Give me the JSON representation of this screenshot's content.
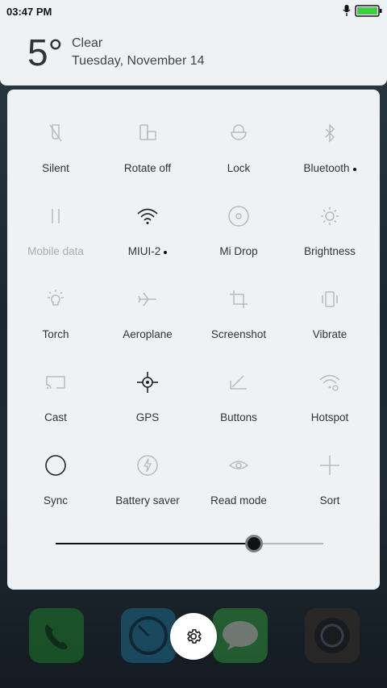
{
  "status_bar": {
    "time": "03:47 PM",
    "battery_icon": "battery-full-icon",
    "mic_icon": "microphone-icon"
  },
  "weather": {
    "temperature": "5°",
    "condition": "Clear",
    "date": "Tuesday, November 14"
  },
  "tiles": [
    {
      "label": "Silent",
      "icon": "silent-icon",
      "active": false
    },
    {
      "label": "Rotate off",
      "icon": "rotate-icon",
      "active": false
    },
    {
      "label": "Lock",
      "icon": "lock-icon",
      "active": false
    },
    {
      "label": "Bluetooth",
      "icon": "bluetooth-icon",
      "active": false,
      "dot": true
    },
    {
      "label": "Mobile data",
      "icon": "mobile-data-icon",
      "active": false,
      "disabled": true
    },
    {
      "label": "MIUI-2",
      "icon": "wifi-icon",
      "active": true,
      "dot": true
    },
    {
      "label": "Mi Drop",
      "icon": "mi-drop-icon",
      "active": false
    },
    {
      "label": "Brightness",
      "icon": "brightness-icon",
      "active": false
    },
    {
      "label": "Torch",
      "icon": "torch-icon",
      "active": false
    },
    {
      "label": "Aeroplane",
      "icon": "aeroplane-icon",
      "active": false
    },
    {
      "label": "Screenshot",
      "icon": "screenshot-icon",
      "active": false
    },
    {
      "label": "Vibrate",
      "icon": "vibrate-icon",
      "active": false
    },
    {
      "label": "Cast",
      "icon": "cast-icon",
      "active": false
    },
    {
      "label": "GPS",
      "icon": "gps-icon",
      "active": true
    },
    {
      "label": "Buttons",
      "icon": "buttons-icon",
      "active": false
    },
    {
      "label": "Hotspot",
      "icon": "hotspot-icon",
      "active": false
    },
    {
      "label": "Sync",
      "icon": "sync-icon",
      "active": true
    },
    {
      "label": "Battery saver",
      "icon": "battery-saver-icon",
      "active": false
    },
    {
      "label": "Read mode",
      "icon": "read-mode-icon",
      "active": false
    },
    {
      "label": "Sort",
      "icon": "sort-icon",
      "active": false
    }
  ],
  "brightness_level": 0.74,
  "colors": {
    "active_icon": "#222222",
    "inactive_icon": "#b6bbbe",
    "panel_bg": "#eef2f4"
  },
  "dock": [
    {
      "icon": "phone-icon",
      "color": "#1f7a2c"
    },
    {
      "icon": "browser-icon",
      "color": "#1d6b8c"
    },
    {
      "icon": "messages-icon",
      "color": "#2f8f3a"
    },
    {
      "icon": "camera-icon",
      "color": "#3a3026"
    }
  ],
  "settings_icon": "gear-icon"
}
